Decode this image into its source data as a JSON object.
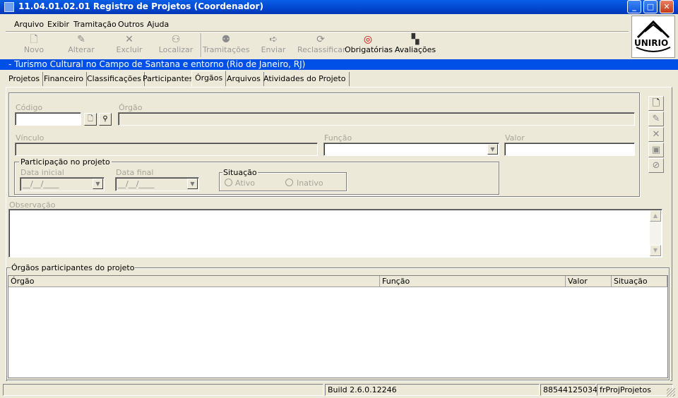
{
  "window": {
    "title": "11.04.01.02.01 Registro de Projetos (Coordenador)"
  },
  "menu": [
    "Arquivo",
    "Exibir",
    "Tramitação",
    "Outros",
    "Ajuda"
  ],
  "toolbar": {
    "novo": "Novo",
    "alterar": "Alterar",
    "excluir": "Excluir",
    "localizar": "Localizar",
    "tramitacoes": "Tramitações",
    "enviar": "Enviar",
    "reclassificar": "Reclassificar",
    "obrigatorias": "Obrigatórias",
    "avaliacoes": "Avaliações"
  },
  "logo": {
    "text": "UNIRIO"
  },
  "project": {
    "title": "- Turismo Cultural no Campo de Santana e entorno (Rio de Janeiro, RJ)"
  },
  "tabs": [
    "Projetos",
    "Financeiro",
    "Classificações",
    "Participantes",
    "Órgãos",
    "Arquivos",
    "Atividades do Projeto"
  ],
  "form": {
    "codigo_label": "Código",
    "orgao_label": "Órgão",
    "vinculo_label": "Vínculo",
    "funcao_label": "Função",
    "valor_label": "Valor",
    "participacao_label": "Participação no projeto",
    "data_inicial_label": "Data inicial",
    "data_final_label": "Data final",
    "data_inicial_value": "__/__/____",
    "data_final_value": "__/__/____",
    "situacao_label": "Situação",
    "ativo_label": "Ativo",
    "inativo_label": "Inativo",
    "observacao_label": "Observação"
  },
  "grid": {
    "title": "Órgãos participantes do projeto",
    "columns": [
      "Órgão",
      "Função",
      "Valor",
      "Situação"
    ]
  },
  "status": {
    "build": "Build 2.6.0.12246",
    "code": "88544125034",
    "form": "frProjProjetos"
  }
}
